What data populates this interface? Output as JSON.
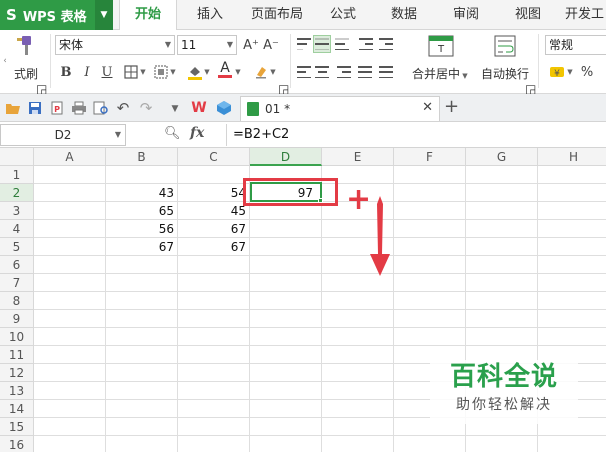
{
  "app": {
    "name": "WPS 表格",
    "logo": "S"
  },
  "tabs": [
    "开始",
    "插入",
    "页面布局",
    "公式",
    "数据",
    "审阅",
    "视图",
    "开发工"
  ],
  "active_tab": "开始",
  "ribbon": {
    "format_painter_label": "式刷",
    "font_name": "宋体",
    "font_size": "11",
    "merge_center_label": "合并居中",
    "wrap_label": "自动换行",
    "number_format": "常规",
    "percent_symbol": "%",
    "bold": "B",
    "italic": "I",
    "underline": "U",
    "grow_font": "A⁺",
    "shrink_font": "A⁻",
    "font_color_letter": "A",
    "merge_icon_letter": "T"
  },
  "document": {
    "tab_title": "01 *"
  },
  "formula_bar": {
    "cell_ref": "D2",
    "fx": "fx",
    "formula": "=B2+C2"
  },
  "grid": {
    "columns": [
      "A",
      "B",
      "C",
      "D",
      "E",
      "F",
      "G",
      "H"
    ],
    "rows": [
      "1",
      "2",
      "3",
      "4",
      "5",
      "6",
      "7",
      "8",
      "9",
      "10",
      "11",
      "12",
      "13",
      "14",
      "15",
      "16"
    ],
    "cells": {
      "B2": "43",
      "C2": "54",
      "D2": "97",
      "B3": "65",
      "C3": "45",
      "B4": "56",
      "C4": "67",
      "B5": "67",
      "C5": "67"
    },
    "selected_cell": "D2"
  },
  "annotation": {
    "color": "#e33b45",
    "plus": "+"
  },
  "watermark": {
    "title": "百科全说",
    "subtitle": "助你轻松解决"
  },
  "colors": {
    "accent": "#2f9b46",
    "annotation": "#e33b45"
  }
}
